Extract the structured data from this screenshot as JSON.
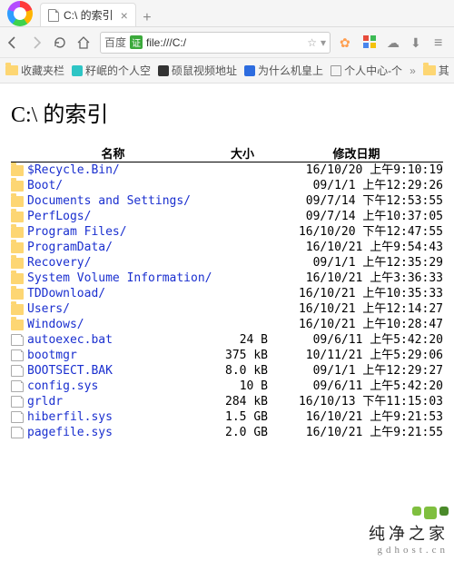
{
  "tab": {
    "title": "C:\\ 的索引"
  },
  "address": {
    "engine": "百度",
    "cert": "证",
    "url": "file:///C:/"
  },
  "bookmarks": [
    {
      "label": "收藏夹栏",
      "icon": "folder"
    },
    {
      "label": "籽岷的个人空",
      "icon": "cyan"
    },
    {
      "label": "硕鼠视频地址",
      "icon": "dark"
    },
    {
      "label": "为什么机皇上",
      "icon": "blue"
    },
    {
      "label": "个人中心-个",
      "icon": "page"
    },
    {
      "label": "其",
      "icon": "folder"
    }
  ],
  "page": {
    "heading": "C:\\ 的索引"
  },
  "columns": {
    "name": "名称",
    "size": "大小",
    "date": "修改日期"
  },
  "entries": [
    {
      "type": "dir",
      "name": "$Recycle.Bin/",
      "size": "",
      "date": "16/10/20 上午9:10:19"
    },
    {
      "type": "dir",
      "name": "Boot/",
      "size": "",
      "date": "09/1/1 上午12:29:26"
    },
    {
      "type": "dir",
      "name": "Documents and Settings/",
      "size": "",
      "date": "09/7/14 下午12:53:55"
    },
    {
      "type": "dir",
      "name": "PerfLogs/",
      "size": "",
      "date": "09/7/14 上午10:37:05"
    },
    {
      "type": "dir",
      "name": "Program Files/",
      "size": "",
      "date": "16/10/20 下午12:47:55"
    },
    {
      "type": "dir",
      "name": "ProgramData/",
      "size": "",
      "date": "16/10/21 上午9:54:43"
    },
    {
      "type": "dir",
      "name": "Recovery/",
      "size": "",
      "date": "09/1/1 上午12:35:29"
    },
    {
      "type": "dir",
      "name": "System Volume Information/",
      "size": "",
      "date": "16/10/21 上午3:36:33"
    },
    {
      "type": "dir",
      "name": "TDDownload/",
      "size": "",
      "date": "16/10/21 上午10:35:33"
    },
    {
      "type": "dir",
      "name": "Users/",
      "size": "",
      "date": "16/10/21 上午12:14:27"
    },
    {
      "type": "dir",
      "name": "Windows/",
      "size": "",
      "date": "16/10/21 上午10:28:47"
    },
    {
      "type": "file",
      "name": "autoexec.bat",
      "size": "24 B",
      "date": "09/6/11 上午5:42:20"
    },
    {
      "type": "file",
      "name": "bootmgr",
      "size": "375 kB",
      "date": "10/11/21 上午5:29:06"
    },
    {
      "type": "file",
      "name": "BOOTSECT.BAK",
      "size": "8.0 kB",
      "date": "09/1/1 上午12:29:27"
    },
    {
      "type": "file",
      "name": "config.sys",
      "size": "10 B",
      "date": "09/6/11 上午5:42:20"
    },
    {
      "type": "file",
      "name": "grldr",
      "size": "284 kB",
      "date": "16/10/13 下午11:15:03"
    },
    {
      "type": "file",
      "name": "hiberfil.sys",
      "size": "1.5 GB",
      "date": "16/10/21 上午9:21:53"
    },
    {
      "type": "file",
      "name": "pagefile.sys",
      "size": "2.0 GB",
      "date": "16/10/21 上午9:21:55"
    }
  ],
  "watermark": {
    "text": "纯净之家",
    "url": "gdhost.cn"
  }
}
